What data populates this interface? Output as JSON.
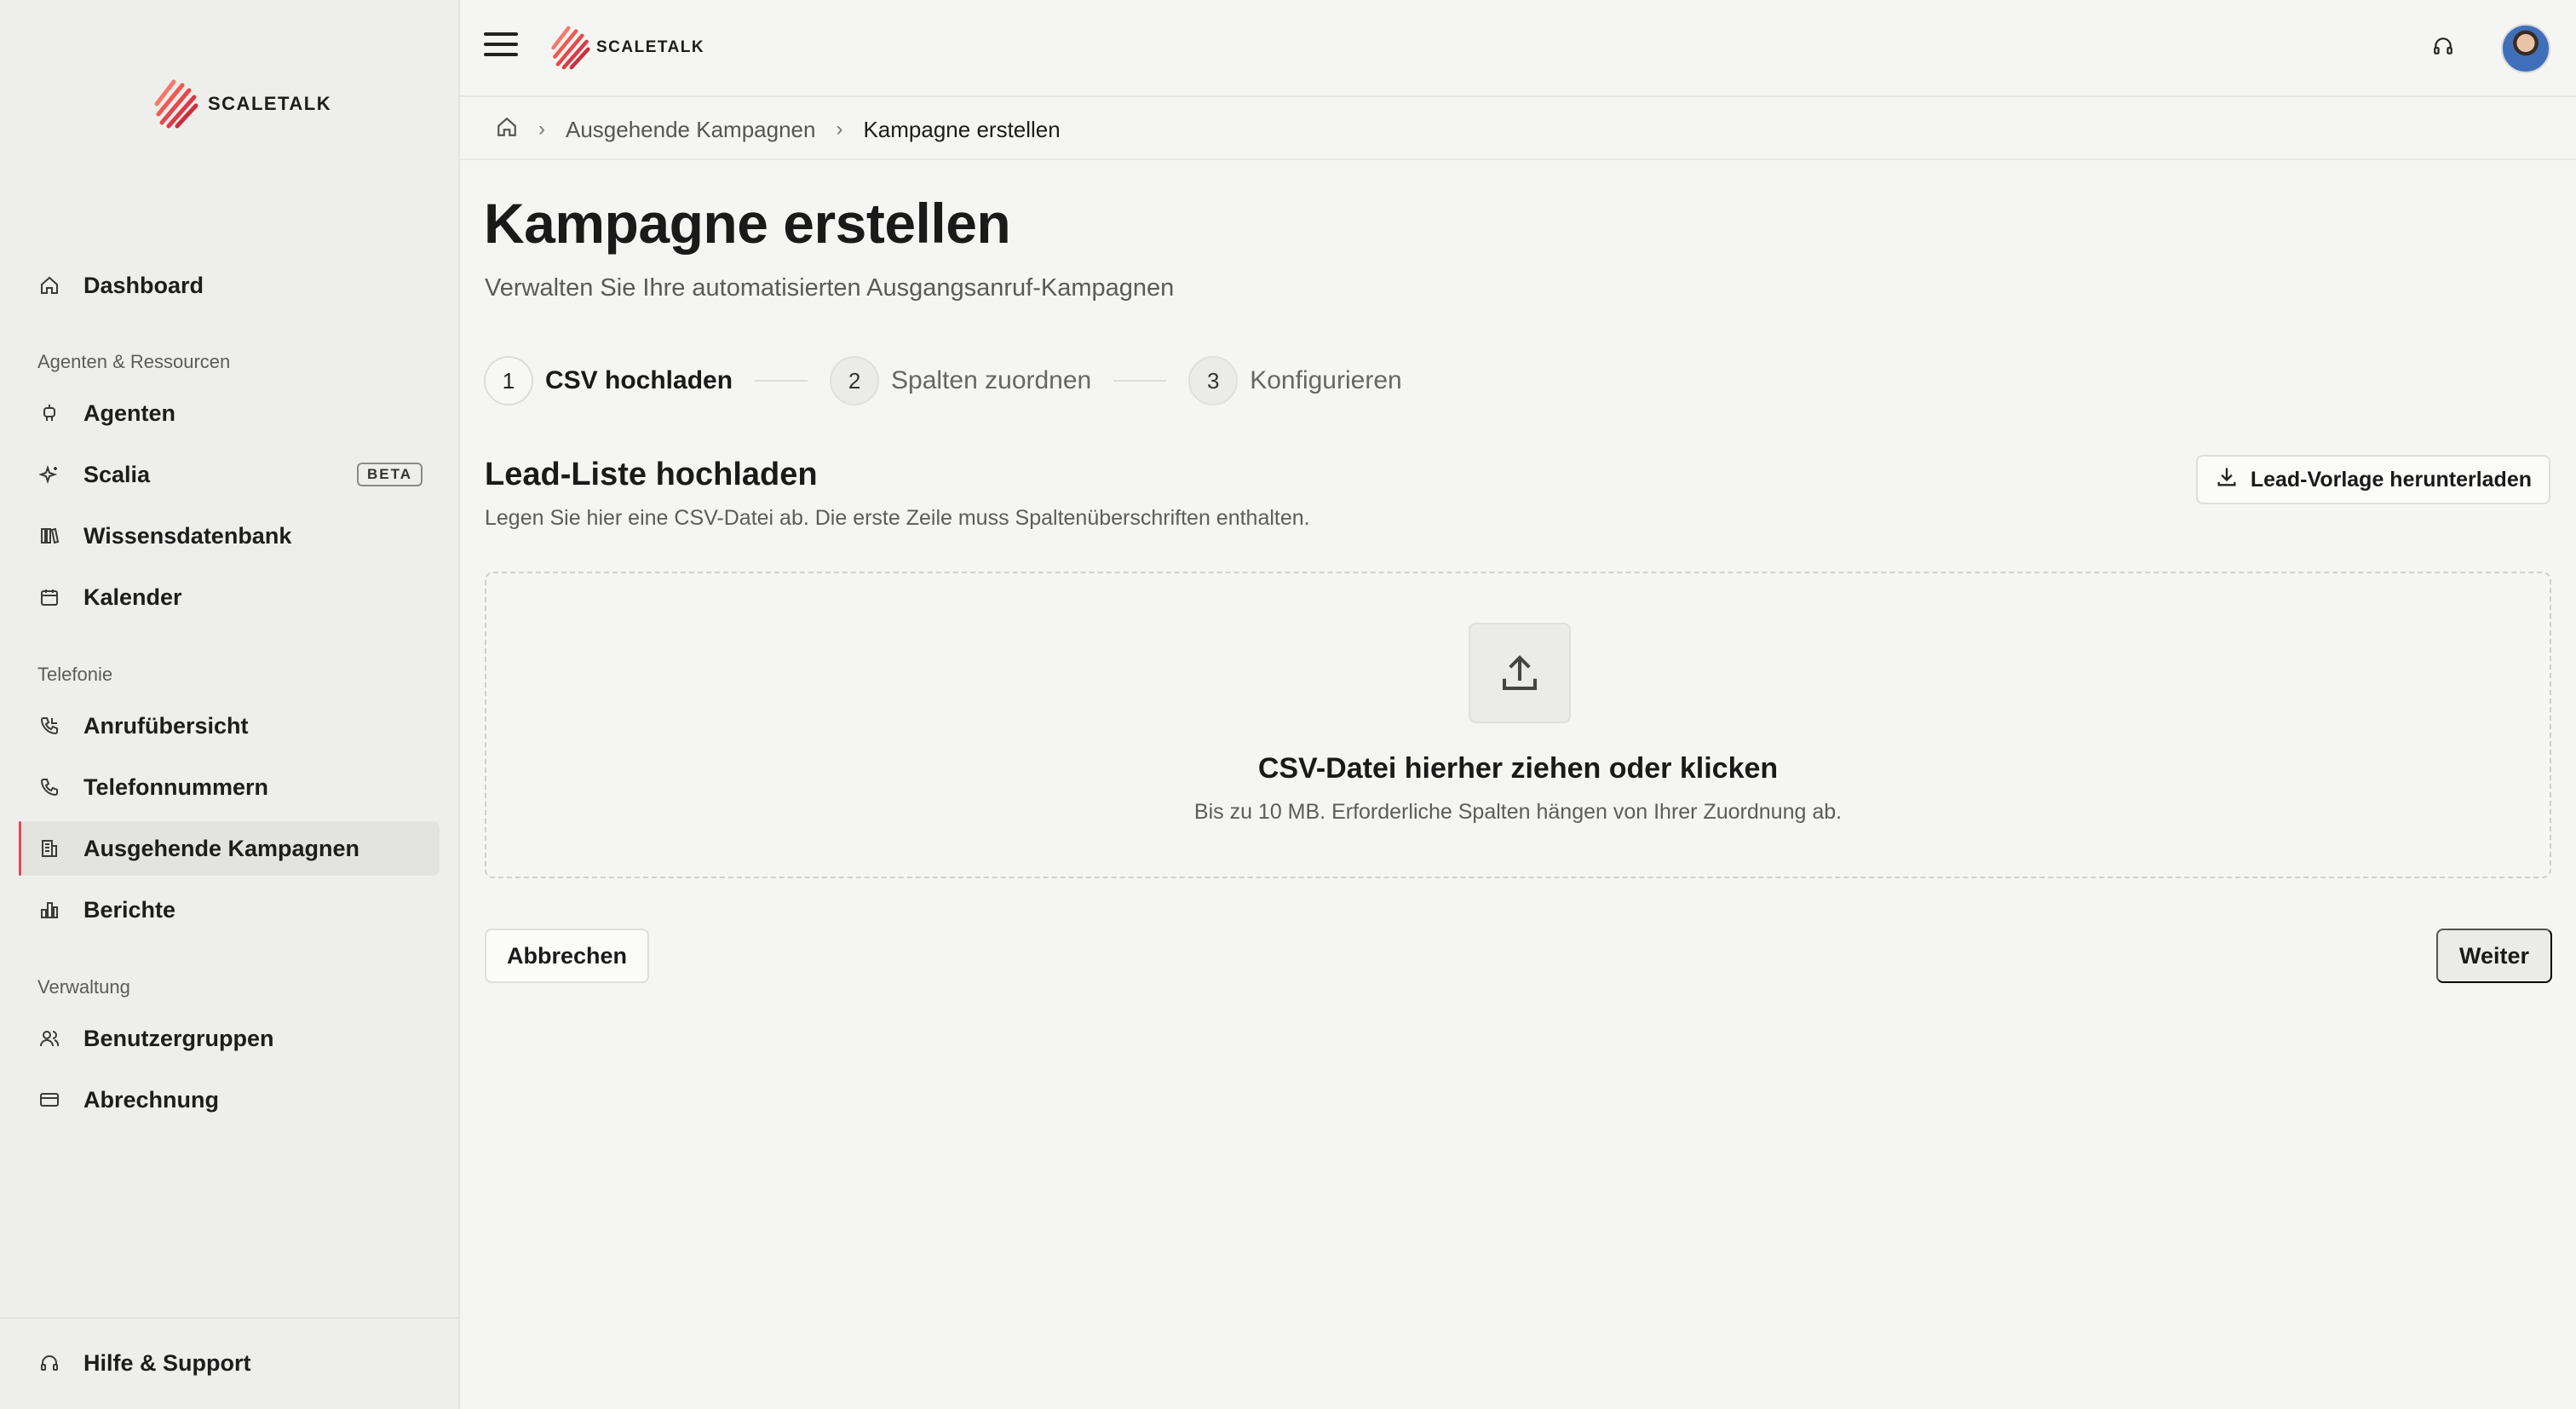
{
  "brand": {
    "name": "SCALETALK",
    "accent": "#e5484d"
  },
  "sidebar": {
    "dashboard": "Dashboard",
    "section_agents": "Agenten & Ressourcen",
    "agents": "Agenten",
    "scalia": "Scalia",
    "scalia_badge": "BETA",
    "knowledge": "Wissensdatenbank",
    "calendar": "Kalender",
    "section_telephony": "Telefonie",
    "calls": "Anrufübersicht",
    "numbers": "Telefonnummern",
    "campaigns": "Ausgehende Kampagnen",
    "reports": "Berichte",
    "section_admin": "Verwaltung",
    "usergroups": "Benutzergruppen",
    "billing": "Abrechnung",
    "help": "Hilfe & Support"
  },
  "breadcrumb": {
    "parent": "Ausgehende Kampagnen",
    "current": "Kampagne erstellen"
  },
  "page": {
    "title": "Kampagne erstellen",
    "subtitle": "Verwalten Sie Ihre automatisierten Ausgangsanruf-Kampagnen"
  },
  "steps": [
    {
      "num": "1",
      "label": "CSV hochladen"
    },
    {
      "num": "2",
      "label": "Spalten zuordnen"
    },
    {
      "num": "3",
      "label": "Konfigurieren"
    }
  ],
  "upload": {
    "title": "Lead-Liste hochladen",
    "subtitle": "Legen Sie hier eine CSV-Datei ab. Die erste Zeile muss Spaltenüberschriften enthalten.",
    "template_button": "Lead-Vorlage herunterladen",
    "drop_title": "CSV-Datei hierher ziehen oder klicken",
    "drop_subtitle": "Bis zu 10 MB. Erforderliche Spalten hängen von Ihrer Zuordnung ab."
  },
  "actions": {
    "cancel": "Abbrechen",
    "next": "Weiter"
  }
}
